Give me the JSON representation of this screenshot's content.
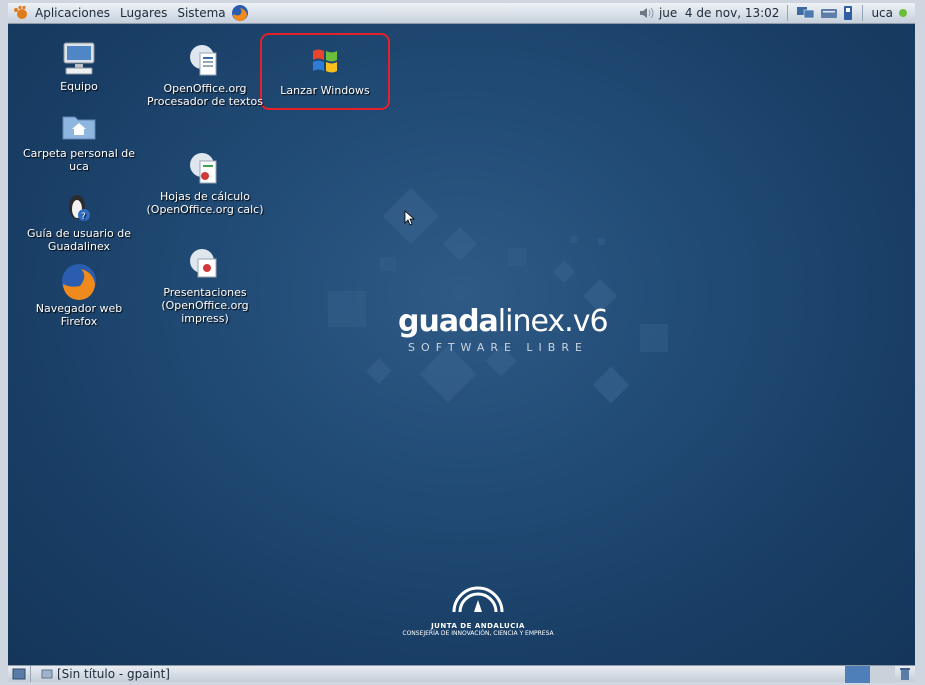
{
  "top_panel": {
    "menus": [
      "Aplicaciones",
      "Lugares",
      "Sistema"
    ],
    "clock": "jue  4 de nov, 13:02",
    "user": "uca"
  },
  "desktop": {
    "icons": [
      {
        "label": "Equipo"
      },
      {
        "label": "Carpeta personal de uca"
      },
      {
        "label": "Guía de usuario de Guadalinex"
      },
      {
        "label": "Navegador web Firefox"
      },
      {
        "label": "OpenOffice.org Procesador de textos"
      },
      {
        "label": "Hojas de cálculo (OpenOffice.org calc)"
      },
      {
        "label": "Presentaciones (OpenOffice.org impress)"
      },
      {
        "label": "Lanzar Windows"
      }
    ],
    "brand": {
      "name_bold": "guada",
      "name_light": "linex",
      "version": ".v6",
      "tagline": "SOFTWARE LIBRE"
    },
    "footer": {
      "org": "JUNTA DE ANDALUCIA",
      "dept": "CONSEJERÍA DE INNOVACIÓN, CIENCIA Y EMPRESA"
    }
  },
  "bottom_panel": {
    "task": "[Sin título - gpaint]"
  },
  "colors": {
    "desktop_bg": "#204a74",
    "selection": "#e4202a"
  }
}
